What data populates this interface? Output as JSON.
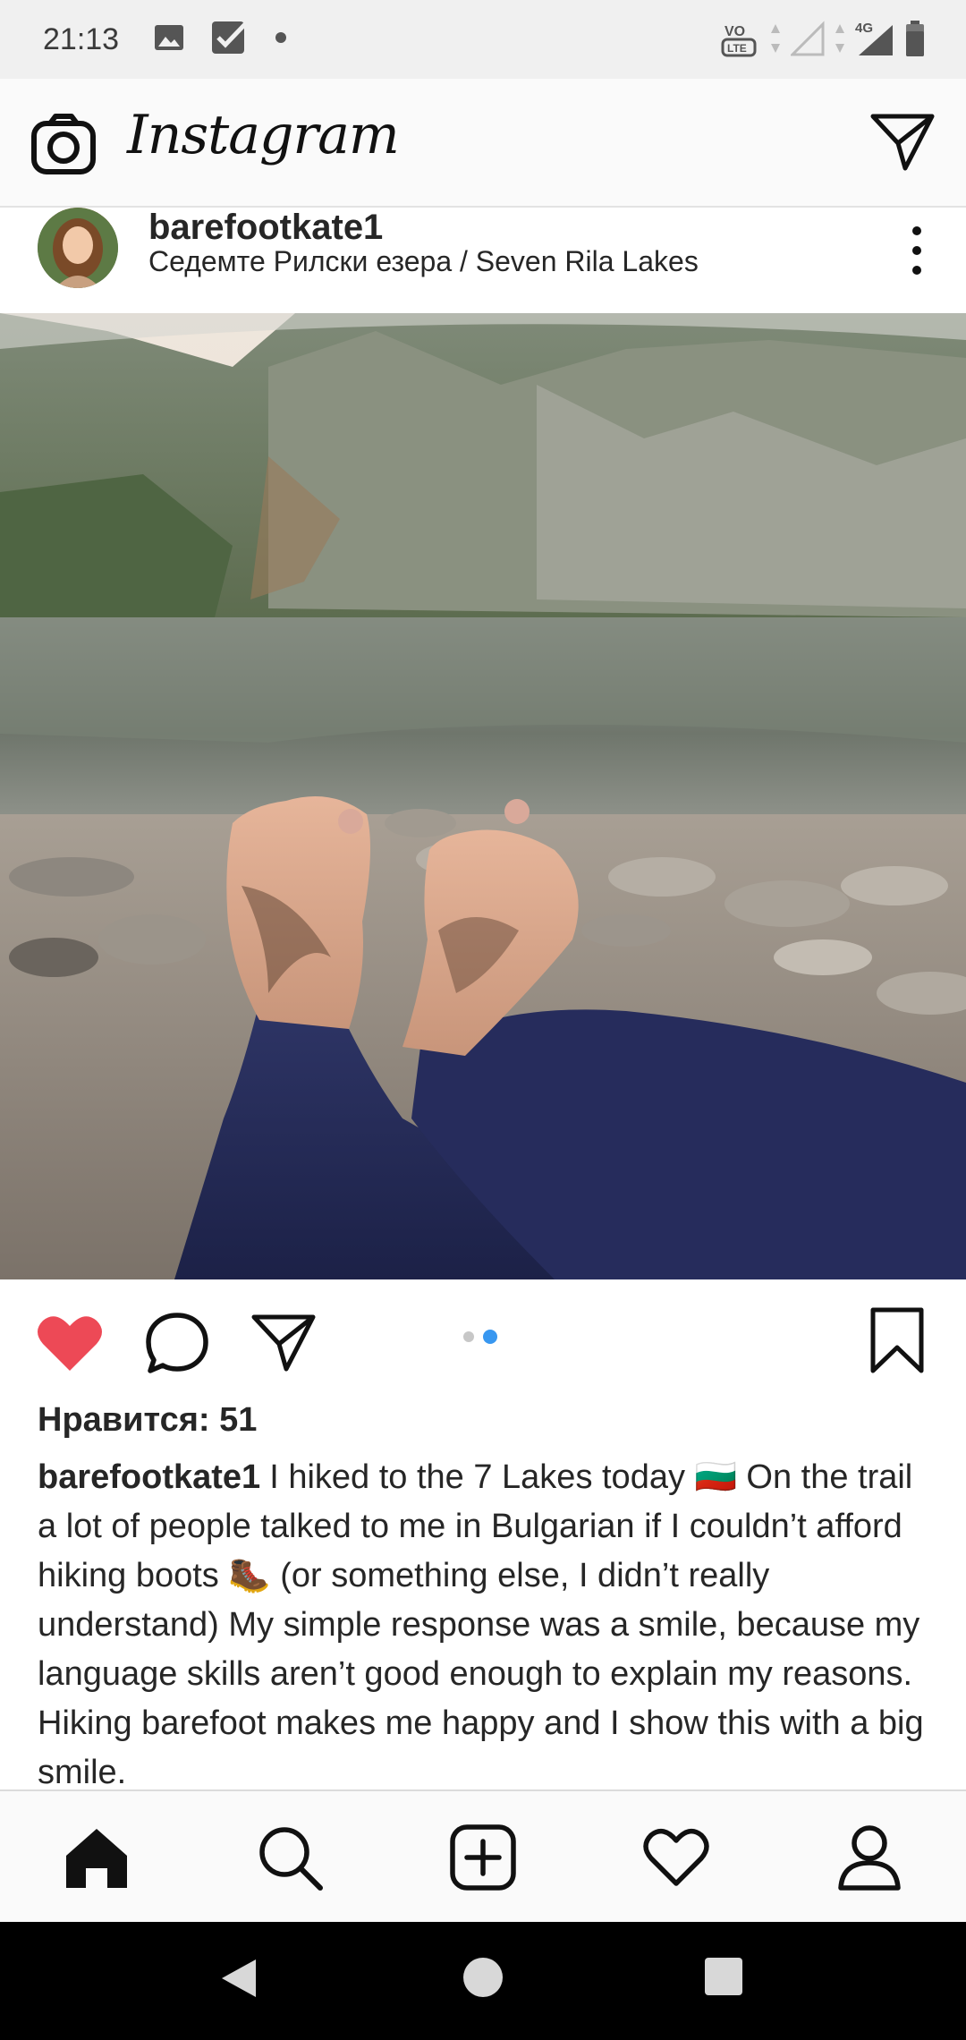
{
  "status_bar": {
    "time": "21:13",
    "icons": [
      "image-icon",
      "checkbox-icon",
      "dot-icon",
      "volte-icon",
      "signal-icon",
      "4g-icon",
      "battery-icon"
    ],
    "volte_label": "VO LTE",
    "network_label": "4G"
  },
  "header": {
    "logo_text": "Instagram"
  },
  "post": {
    "username": "barefootkate1",
    "location": "Седемте Рилски езера / Seven Rila Lakes",
    "likes_text": "Нравится: 51",
    "caption_user": "barefootkate1",
    "caption_text": "I hiked to the 7 Lakes today 🇧🇬 On the trail a lot of people talked to me in Bulgarian if I couldn’t afford hiking boots 🥾 (or something else, I didn’t really understand) My simple response was a smile, because my language skills aren’t good enough to explain my reasons. Hiking barefoot makes me happy and I show this with a big smile.",
    "carousel": {
      "count": 2,
      "active_index": 1
    },
    "liked": true
  },
  "colors": {
    "like_red": "#ed4956",
    "carousel_blue": "#3897f0",
    "text": "#262626"
  }
}
